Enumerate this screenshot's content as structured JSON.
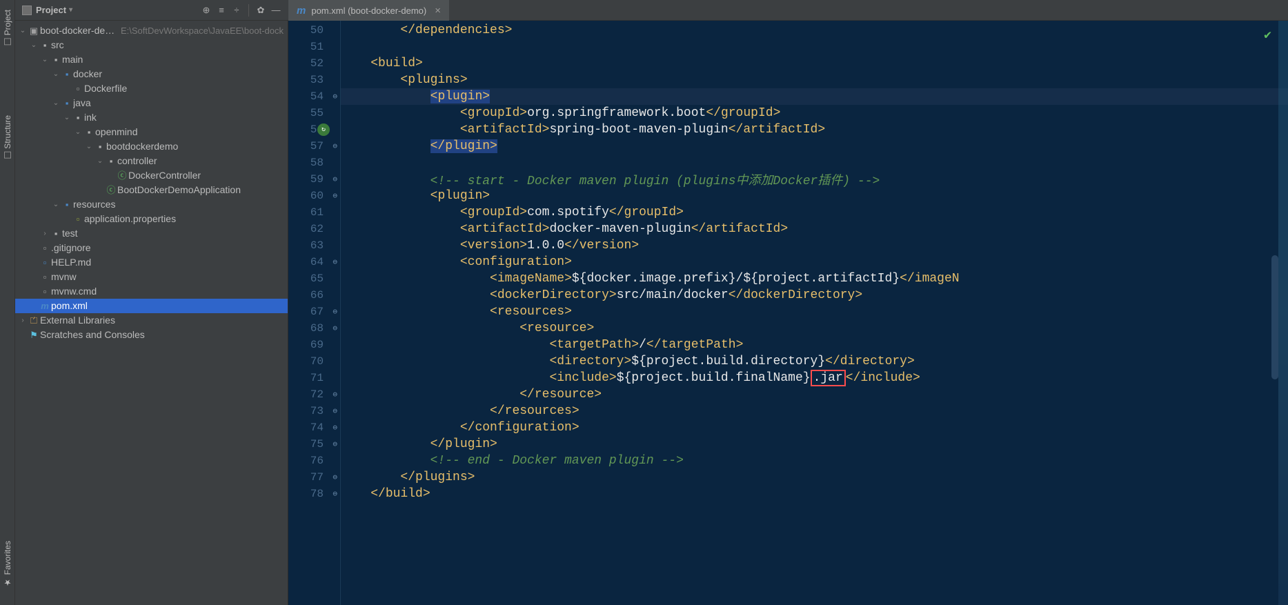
{
  "sideTabs": {
    "project": "Project",
    "structure": "Structure",
    "favorites": "Favorites"
  },
  "topBar": {
    "projectLabel": "Project"
  },
  "fileTab": {
    "label": "pom.xml (boot-docker-demo)"
  },
  "tree": [
    {
      "depth": 0,
      "arrow": "open",
      "icon": "proj",
      "label": "boot-docker-demo",
      "hint": "E:\\SoftDevWorkspace\\JavaEE\\boot-dock"
    },
    {
      "depth": 1,
      "arrow": "open",
      "icon": "folder",
      "label": "src"
    },
    {
      "depth": 2,
      "arrow": "open",
      "icon": "folder",
      "label": "main"
    },
    {
      "depth": 3,
      "arrow": "open",
      "icon": "bluefolder",
      "label": "docker"
    },
    {
      "depth": 4,
      "arrow": "none",
      "icon": "file",
      "label": "Dockerfile"
    },
    {
      "depth": 3,
      "arrow": "open",
      "icon": "bluefolder",
      "label": "java"
    },
    {
      "depth": 4,
      "arrow": "open",
      "icon": "folder",
      "label": "ink"
    },
    {
      "depth": 5,
      "arrow": "open",
      "icon": "folder",
      "label": "openmind"
    },
    {
      "depth": 6,
      "arrow": "open",
      "icon": "folder",
      "label": "bootdockerdemo"
    },
    {
      "depth": 7,
      "arrow": "open",
      "icon": "folder",
      "label": "controller"
    },
    {
      "depth": 8,
      "arrow": "none",
      "icon": "class",
      "label": "DockerController"
    },
    {
      "depth": 7,
      "arrow": "none",
      "icon": "classrun",
      "label": "BootDockerDemoApplication"
    },
    {
      "depth": 3,
      "arrow": "open",
      "icon": "bluefolder",
      "label": "resources"
    },
    {
      "depth": 4,
      "arrow": "none",
      "icon": "prop",
      "label": "application.properties"
    },
    {
      "depth": 2,
      "arrow": "closed",
      "icon": "folder",
      "label": "test"
    },
    {
      "depth": 1,
      "arrow": "none",
      "icon": "file",
      "label": ".gitignore"
    },
    {
      "depth": 1,
      "arrow": "none",
      "icon": "md",
      "label": "HELP.md"
    },
    {
      "depth": 1,
      "arrow": "none",
      "icon": "file",
      "label": "mvnw"
    },
    {
      "depth": 1,
      "arrow": "none",
      "icon": "file",
      "label": "mvnw.cmd"
    },
    {
      "depth": 1,
      "arrow": "none",
      "icon": "pom",
      "label": "pom.xml",
      "selected": true
    },
    {
      "depth": 0,
      "arrow": "closed",
      "icon": "lib",
      "label": "External Libraries"
    },
    {
      "depth": 0,
      "arrow": "none",
      "icon": "scratch",
      "label": "Scratches and Consoles"
    }
  ],
  "code": {
    "startLine": 50,
    "lines": [
      {
        "n": 50,
        "seg": [
          {
            "c": "t-bracket",
            "t": "        </"
          },
          {
            "c": "t-tag",
            "t": "dependencies"
          },
          {
            "c": "t-bracket",
            "t": ">"
          }
        ]
      },
      {
        "n": 51,
        "seg": []
      },
      {
        "n": 52,
        "seg": [
          {
            "c": "t-bracket",
            "t": "    <"
          },
          {
            "c": "t-tag",
            "t": "build"
          },
          {
            "c": "t-bracket",
            "t": ">"
          }
        ]
      },
      {
        "n": 53,
        "seg": [
          {
            "c": "t-bracket",
            "t": "        <"
          },
          {
            "c": "t-tag",
            "t": "plugins"
          },
          {
            "c": "t-bracket",
            "t": ">"
          }
        ]
      },
      {
        "n": 54,
        "hl": true,
        "fold": "–",
        "seg": [
          {
            "c": "t-bracket",
            "t": "            "
          },
          {
            "c": "t-bracket t-hilite",
            "t": "<"
          },
          {
            "c": "t-tag t-hilite",
            "t": "plugin"
          },
          {
            "c": "t-bracket t-hilite",
            "t": ">"
          }
        ]
      },
      {
        "n": 55,
        "seg": [
          {
            "c": "t-bracket",
            "t": "                <"
          },
          {
            "c": "t-tag",
            "t": "groupId"
          },
          {
            "c": "t-bracket",
            "t": ">"
          },
          {
            "c": "t-text",
            "t": "org.springframework.boot"
          },
          {
            "c": "t-bracket",
            "t": "</"
          },
          {
            "c": "t-tag",
            "t": "groupId"
          },
          {
            "c": "t-bracket",
            "t": ">"
          }
        ]
      },
      {
        "n": 56,
        "run": true,
        "seg": [
          {
            "c": "t-bracket",
            "t": "                <"
          },
          {
            "c": "t-tag",
            "t": "artifactId"
          },
          {
            "c": "t-bracket",
            "t": ">"
          },
          {
            "c": "t-text",
            "t": "spring-boot-maven-plugin"
          },
          {
            "c": "t-bracket",
            "t": "</"
          },
          {
            "c": "t-tag",
            "t": "artifactId"
          },
          {
            "c": "t-bracket",
            "t": ">"
          }
        ]
      },
      {
        "n": 57,
        "fold": "–",
        "seg": [
          {
            "c": "t-bracket",
            "t": "            "
          },
          {
            "c": "t-bracket t-hilite",
            "t": "</"
          },
          {
            "c": "t-tag t-hilite",
            "t": "plugin"
          },
          {
            "c": "t-bracket t-hilite",
            "t": ">"
          }
        ]
      },
      {
        "n": 58,
        "seg": []
      },
      {
        "n": 59,
        "fold": "–",
        "seg": [
          {
            "c": "t-comment",
            "t": "            <!-- start - Docker maven plugin (plugins中添加Docker插件) -->"
          }
        ]
      },
      {
        "n": 60,
        "fold": "–",
        "seg": [
          {
            "c": "t-bracket",
            "t": "            <"
          },
          {
            "c": "t-tag",
            "t": "plugin"
          },
          {
            "c": "t-bracket",
            "t": ">"
          }
        ]
      },
      {
        "n": 61,
        "seg": [
          {
            "c": "t-bracket",
            "t": "                <"
          },
          {
            "c": "t-tag",
            "t": "groupId"
          },
          {
            "c": "t-bracket",
            "t": ">"
          },
          {
            "c": "t-text",
            "t": "com.spotify"
          },
          {
            "c": "t-bracket",
            "t": "</"
          },
          {
            "c": "t-tag",
            "t": "groupId"
          },
          {
            "c": "t-bracket",
            "t": ">"
          }
        ]
      },
      {
        "n": 62,
        "seg": [
          {
            "c": "t-bracket",
            "t": "                <"
          },
          {
            "c": "t-tag",
            "t": "artifactId"
          },
          {
            "c": "t-bracket",
            "t": ">"
          },
          {
            "c": "t-text",
            "t": "docker-maven-plugin"
          },
          {
            "c": "t-bracket",
            "t": "</"
          },
          {
            "c": "t-tag",
            "t": "artifactId"
          },
          {
            "c": "t-bracket",
            "t": ">"
          }
        ]
      },
      {
        "n": 63,
        "seg": [
          {
            "c": "t-bracket",
            "t": "                <"
          },
          {
            "c": "t-tag",
            "t": "version"
          },
          {
            "c": "t-bracket",
            "t": ">"
          },
          {
            "c": "t-text",
            "t": "1.0.0"
          },
          {
            "c": "t-bracket",
            "t": "</"
          },
          {
            "c": "t-tag",
            "t": "version"
          },
          {
            "c": "t-bracket",
            "t": ">"
          }
        ]
      },
      {
        "n": 64,
        "fold": "–",
        "seg": [
          {
            "c": "t-bracket",
            "t": "                <"
          },
          {
            "c": "t-tag",
            "t": "configuration"
          },
          {
            "c": "t-bracket",
            "t": ">"
          }
        ]
      },
      {
        "n": 65,
        "seg": [
          {
            "c": "t-bracket",
            "t": "                    <"
          },
          {
            "c": "t-tag",
            "t": "imageName"
          },
          {
            "c": "t-bracket",
            "t": ">"
          },
          {
            "c": "t-text",
            "t": "${docker.image.prefix}/${project.artifactId}"
          },
          {
            "c": "t-bracket",
            "t": "</"
          },
          {
            "c": "t-tag",
            "t": "imageN"
          }
        ]
      },
      {
        "n": 66,
        "seg": [
          {
            "c": "t-bracket",
            "t": "                    <"
          },
          {
            "c": "t-tag",
            "t": "dockerDirectory"
          },
          {
            "c": "t-bracket",
            "t": ">"
          },
          {
            "c": "t-text",
            "t": "src/main/docker"
          },
          {
            "c": "t-bracket",
            "t": "</"
          },
          {
            "c": "t-tag",
            "t": "dockerDirectory"
          },
          {
            "c": "t-bracket",
            "t": ">"
          }
        ]
      },
      {
        "n": 67,
        "fold": "–",
        "seg": [
          {
            "c": "t-bracket",
            "t": "                    <"
          },
          {
            "c": "t-tag",
            "t": "resources"
          },
          {
            "c": "t-bracket",
            "t": ">"
          }
        ]
      },
      {
        "n": 68,
        "fold": "–",
        "seg": [
          {
            "c": "t-bracket",
            "t": "                        <"
          },
          {
            "c": "t-tag",
            "t": "resource"
          },
          {
            "c": "t-bracket",
            "t": ">"
          }
        ]
      },
      {
        "n": 69,
        "seg": [
          {
            "c": "t-bracket",
            "t": "                            <"
          },
          {
            "c": "t-tag",
            "t": "targetPath"
          },
          {
            "c": "t-bracket",
            "t": ">"
          },
          {
            "c": "t-text",
            "t": "/"
          },
          {
            "c": "t-bracket",
            "t": "</"
          },
          {
            "c": "t-tag",
            "t": "targetPath"
          },
          {
            "c": "t-bracket",
            "t": ">"
          }
        ]
      },
      {
        "n": 70,
        "seg": [
          {
            "c": "t-bracket",
            "t": "                            <"
          },
          {
            "c": "t-tag",
            "t": "directory"
          },
          {
            "c": "t-bracket",
            "t": ">"
          },
          {
            "c": "t-text",
            "t": "${project.build.directory}"
          },
          {
            "c": "t-bracket",
            "t": "</"
          },
          {
            "c": "t-tag",
            "t": "directory"
          },
          {
            "c": "t-bracket",
            "t": ">"
          }
        ]
      },
      {
        "n": 71,
        "seg": [
          {
            "c": "t-bracket",
            "t": "                            <"
          },
          {
            "c": "t-tag",
            "t": "include"
          },
          {
            "c": "t-bracket",
            "t": ">"
          },
          {
            "c": "t-text",
            "t": "${project.build.finalName}"
          },
          {
            "c": "t-text redbox",
            "t": ".jar"
          },
          {
            "c": "t-bracket",
            "t": "</"
          },
          {
            "c": "t-tag",
            "t": "include"
          },
          {
            "c": "t-bracket",
            "t": ">"
          }
        ]
      },
      {
        "n": 72,
        "fold": "–",
        "seg": [
          {
            "c": "t-bracket",
            "t": "                        </"
          },
          {
            "c": "t-tag",
            "t": "resource"
          },
          {
            "c": "t-bracket",
            "t": ">"
          }
        ]
      },
      {
        "n": 73,
        "fold": "–",
        "seg": [
          {
            "c": "t-bracket",
            "t": "                    </"
          },
          {
            "c": "t-tag",
            "t": "resources"
          },
          {
            "c": "t-bracket",
            "t": ">"
          }
        ]
      },
      {
        "n": 74,
        "fold": "–",
        "seg": [
          {
            "c": "t-bracket",
            "t": "                </"
          },
          {
            "c": "t-tag",
            "t": "configuration"
          },
          {
            "c": "t-bracket",
            "t": ">"
          }
        ]
      },
      {
        "n": 75,
        "fold": "–",
        "seg": [
          {
            "c": "t-bracket",
            "t": "            </"
          },
          {
            "c": "t-tag",
            "t": "plugin"
          },
          {
            "c": "t-bracket",
            "t": ">"
          }
        ]
      },
      {
        "n": 76,
        "seg": [
          {
            "c": "t-comment",
            "t": "            <!-- end - Docker maven plugin -->"
          }
        ]
      },
      {
        "n": 77,
        "fold": "–",
        "seg": [
          {
            "c": "t-bracket",
            "t": "        </"
          },
          {
            "c": "t-tag",
            "t": "plugins"
          },
          {
            "c": "t-bracket",
            "t": ">"
          }
        ]
      },
      {
        "n": 78,
        "fold": "–",
        "seg": [
          {
            "c": "t-bracket",
            "t": "    </"
          },
          {
            "c": "t-tag",
            "t": "build"
          },
          {
            "c": "t-bracket",
            "t": ">"
          }
        ]
      }
    ]
  }
}
